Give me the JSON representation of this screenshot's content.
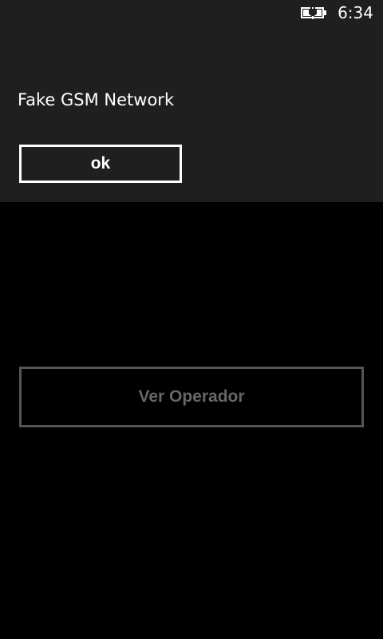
{
  "status_bar": {
    "time": "6:34",
    "battery_icon": "battery-charging-icon"
  },
  "dialog": {
    "message": "Fake GSM Network",
    "ok_label": "ok"
  },
  "main": {
    "operator_button_label": "Ver Operador",
    "operator_button_state": "disabled"
  },
  "colors": {
    "page_background": "#000000",
    "dialog_background": "#1f1f1f",
    "text_primary": "#ffffff",
    "disabled_border": "#555555",
    "disabled_text": "#666666"
  }
}
